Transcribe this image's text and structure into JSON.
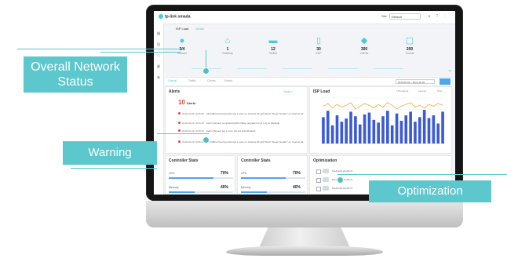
{
  "screen": {
    "logo": "tp-link omada",
    "site_label": "Site",
    "site_value": "Default",
    "subtabs": {
      "active": "ISP Load",
      "inactive": "Detail"
    },
    "topology": [
      {
        "count": "3/4",
        "label": "Internet"
      },
      {
        "count": "1",
        "label": "Gateway"
      },
      {
        "count": "12",
        "label": "Switch"
      },
      {
        "count": "30",
        "label": "EAP"
      },
      {
        "count": "300",
        "label": "Clients"
      },
      {
        "count": "200",
        "label": "Guests"
      }
    ],
    "filter_tabs": [
      "Overall",
      "Traffic",
      "Clients",
      "Switch"
    ],
    "date_range": "2019-06-05 ~ 2019-12-05",
    "alerts": {
      "title": "Alerts",
      "link": "Detail >",
      "count": "10",
      "count_label": "Alerts",
      "rows": [
        {
          "time": "2019-09-22 10:25:36",
          "text": "AP [Office-Floor3] performed a scan on channel 36 with 5GHz \"Neuer Sender\" on channel 44"
        },
        {
          "time": "2019-09-22 10:25:36",
          "text": "Admin [Neuer] completed [EAP-Office] upgraded to [5.1.0] on [Default]"
        },
        {
          "time": "2019-09-22 10:25:36",
          "text": "Admin [Neuer] log in from [10.0.0.113] [Default]"
        },
        {
          "time": "2019-09-22 10:25:36",
          "text": "AP [Office-Floor3] performed a scan on channel 36 with 5GHz \"Neuer Sender\" on channel 44"
        }
      ]
    },
    "isp": {
      "title": "ISP Load",
      "legend_1": "Throughput",
      "legend_2": "Latency",
      "legend_3": "Total"
    },
    "controller_stats_1": {
      "title": "Controller Stats",
      "row1_label": "CPU",
      "row1_value": "70%",
      "row2_label": "Memory",
      "row2_value": "40%"
    },
    "controller_stats_2": {
      "title": "Controller Stats",
      "row1_label": "CPU",
      "row1_value": "70%",
      "row2_label": "Memory",
      "row2_value": "40%"
    },
    "optimization": {
      "title": "Optimization",
      "rows": [
        "WLAN-00-2A-08-7F",
        "WLAN-00-2A-08-7F",
        "WLAN-00-2A-08-7F"
      ]
    }
  },
  "callouts": {
    "network_status": "Overall Network Status",
    "warning": "Warning",
    "optimization": "Optimization"
  },
  "colors": {
    "accent": "#5cc7cc",
    "bars": "#3b5bd6",
    "line": "#f2a53b",
    "alert": "#e0483e"
  },
  "chart_data": {
    "type": "bar",
    "title": "ISP Load",
    "series": [
      {
        "name": "Throughput",
        "values": [
          58,
          72,
          40,
          62,
          48,
          55,
          70,
          60,
          42,
          64,
          68,
          52,
          46,
          60,
          72,
          40,
          66,
          50,
          62,
          70,
          48,
          58,
          74,
          56,
          62,
          44,
          70
        ]
      },
      {
        "name": "Latency",
        "values": [
          82,
          88,
          78,
          86,
          80,
          84,
          90,
          76,
          82,
          88,
          84,
          78,
          86,
          80,
          90,
          84,
          76,
          82,
          86,
          90,
          80,
          84,
          78,
          86,
          82,
          88,
          84
        ]
      }
    ],
    "ylim": [
      0,
      100
    ],
    "grid": true,
    "legend": "top-right"
  }
}
